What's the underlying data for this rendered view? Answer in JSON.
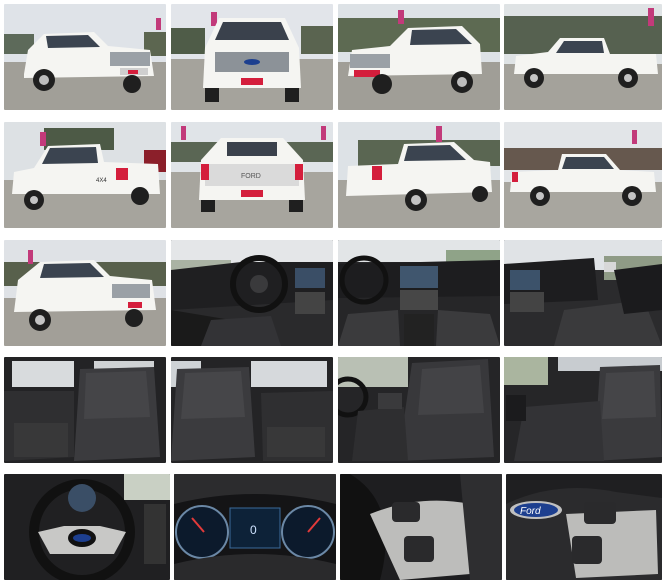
{
  "gallery": {
    "photo_count": 20,
    "brand_colors": {
      "paint": "#f3f3f0",
      "sky": "#dfe3e8",
      "asphalt": "#9a9a94",
      "interior": "#2a2a2c",
      "flag": "#c23a7a",
      "ford_blue": "#1d3f8f"
    },
    "badges": {
      "tailgate": "FORD",
      "side": "4X4",
      "steering": "Ford",
      "cluster": "0"
    }
  }
}
